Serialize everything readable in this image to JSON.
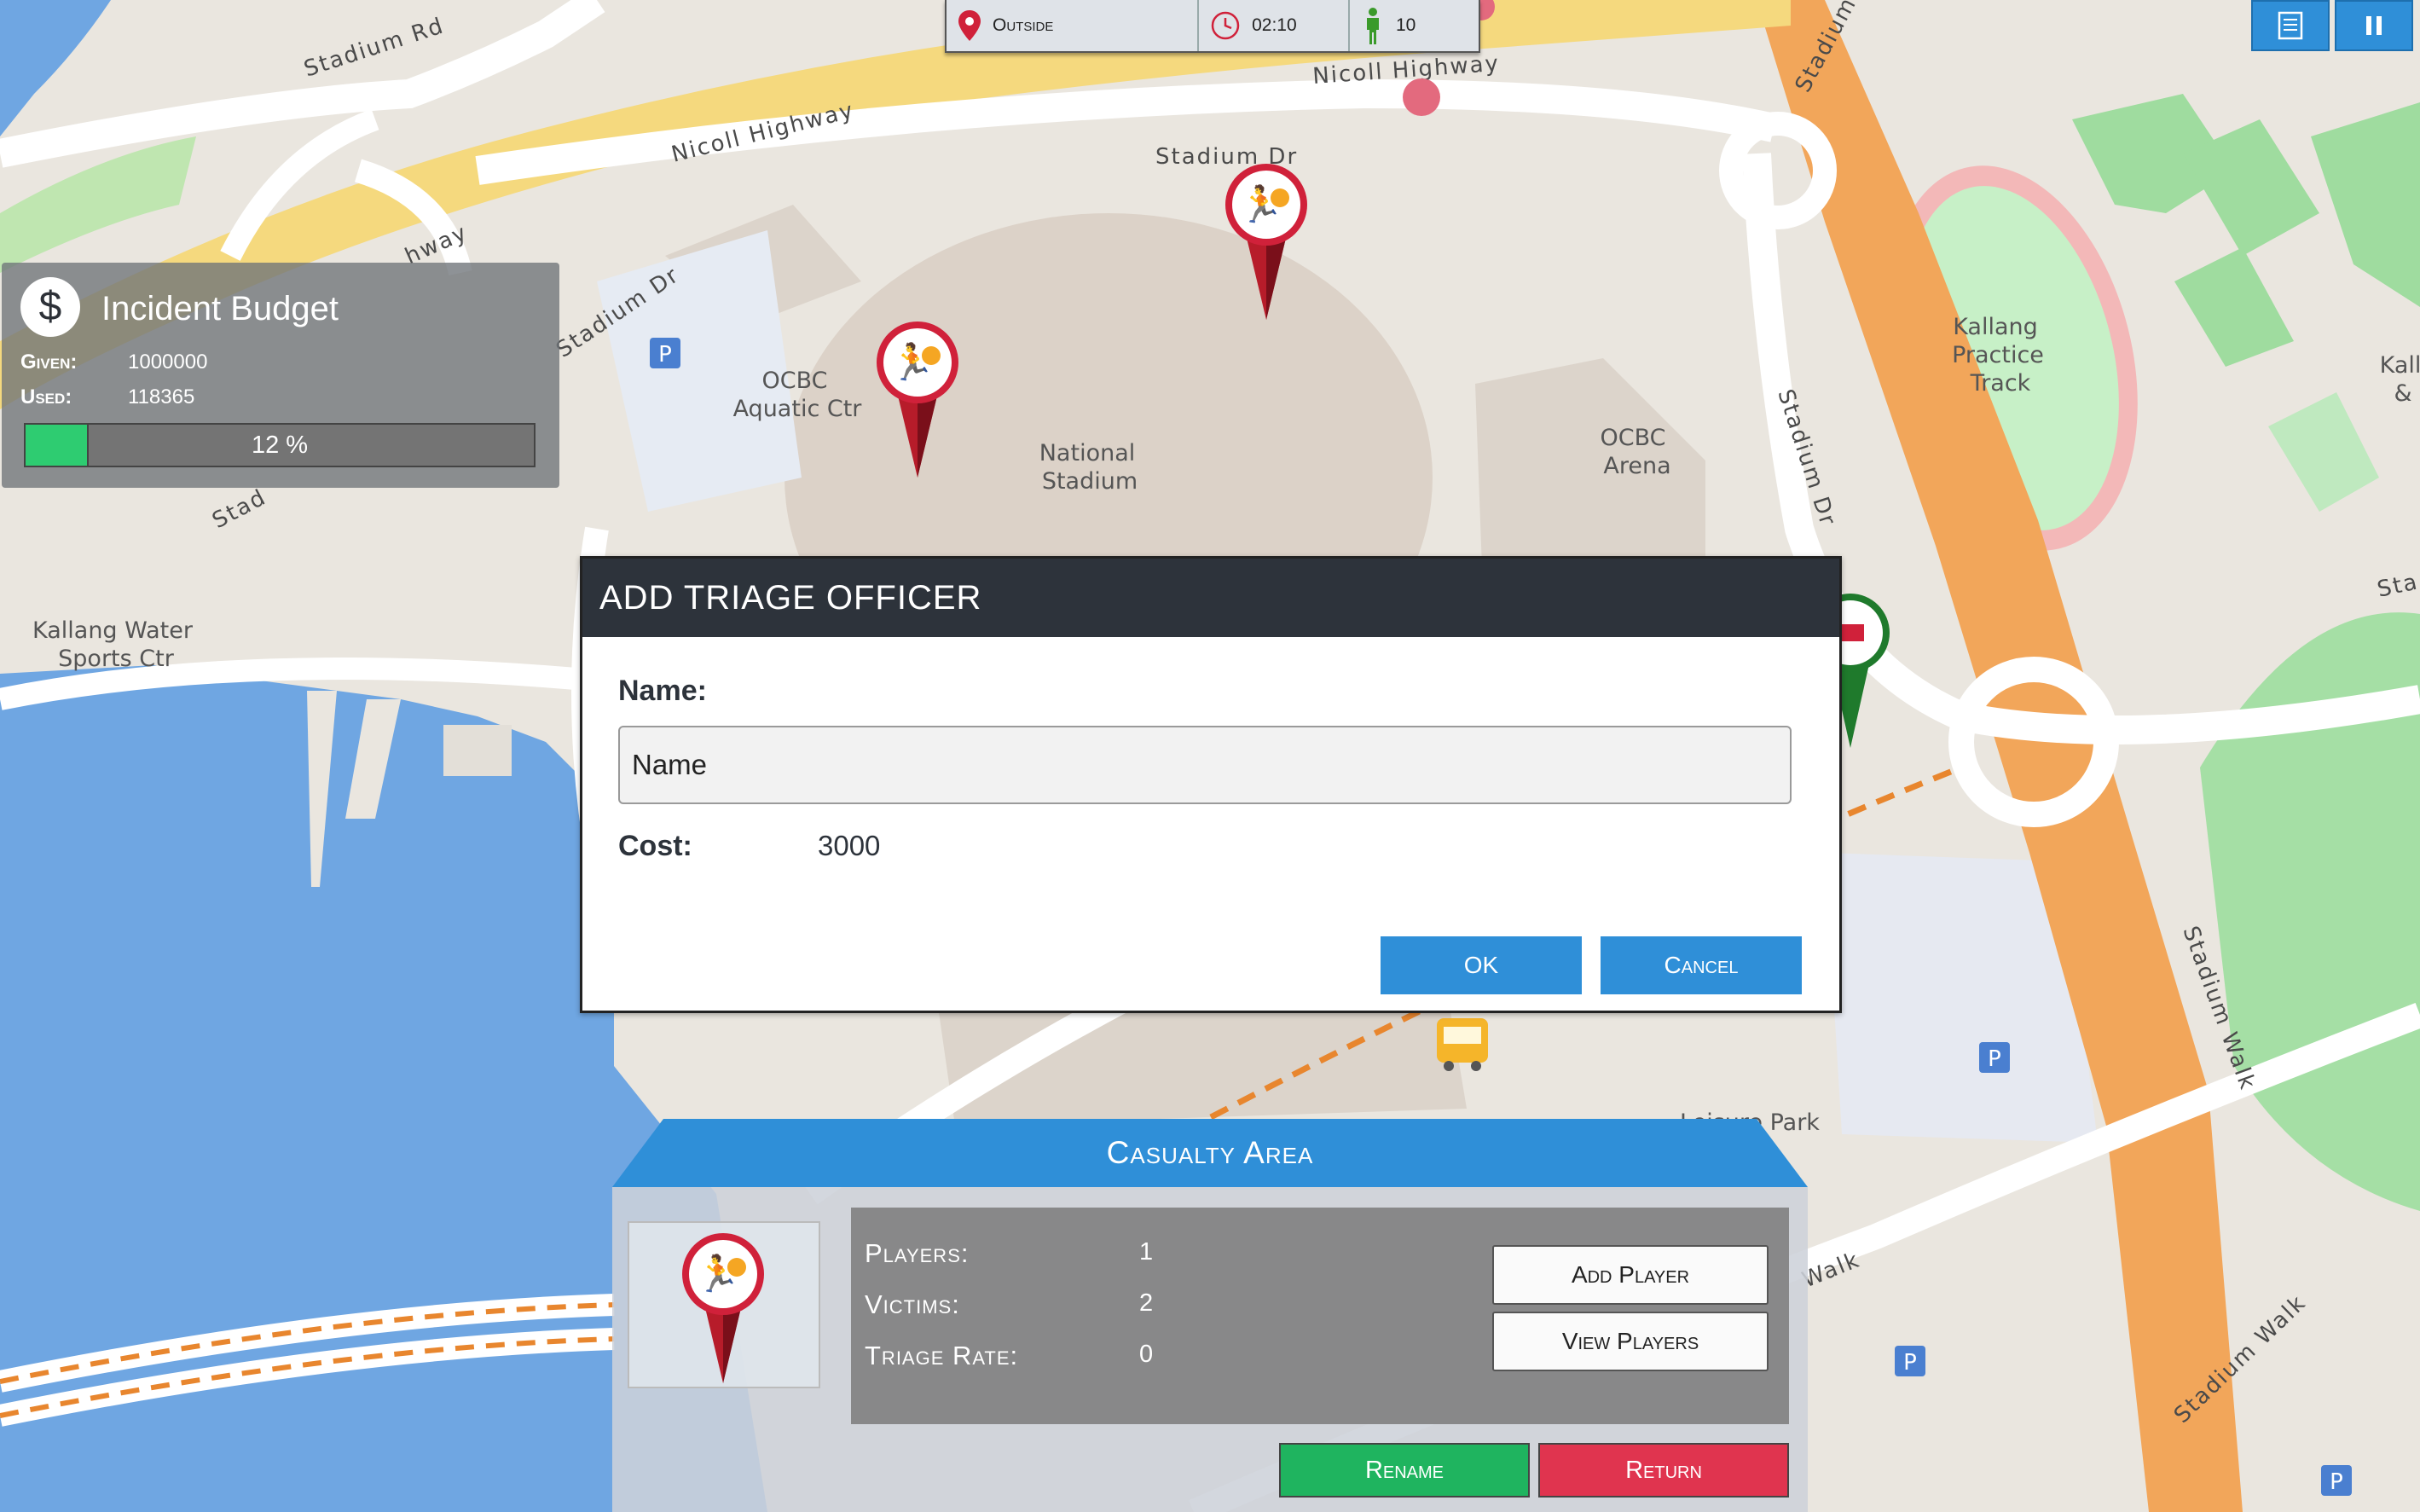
{
  "map": {
    "labels": {
      "stadium_rd": "Stadium Rd",
      "nicoll_highway_1": "Nicoll Highway",
      "nicoll_highway_2": "Nicoll Highway",
      "highway_partial": "hway",
      "stadium_dr_top": "Stadium Dr",
      "stadium_dr_left": "Stadium Dr",
      "stadium_dr_right": "Stadium Dr",
      "stadium_top_right": "Stadium",
      "stad_left": "Stad",
      "stad_right": "Sta",
      "ocbc_aquatic_1": "OCBC",
      "ocbc_aquatic_2": "Aquatic Ctr",
      "national_1": "National",
      "national_2": "Stadium",
      "ocbc_arena_1": "OCBC",
      "ocbc_arena_2": "Arena",
      "kallang_track_1": "Kallang",
      "kallang_track_2": "Practice",
      "kallang_track_3": "Track",
      "kallang_water_1": "Kallang Water",
      "kallang_water_2": "Sports Ctr",
      "leisure_park": "Leisure Park",
      "stadium_walk_1": "Stadium Walk",
      "stadium_walk_2": "Stadium Walk",
      "walk": "Walk",
      "kall_edge_1": "Kall",
      "kall_edge_2": "&"
    }
  },
  "status_bar": {
    "location": "Outside",
    "time": "02:10",
    "players": "10"
  },
  "budget": {
    "title": "Incident Budget",
    "given_label": "Given:",
    "given_value": "1000000",
    "used_label": "Used:",
    "used_value": "118365",
    "progress_text": "12 %",
    "progress_fraction": 0.12
  },
  "dialog": {
    "title": "ADD TRIAGE OFFICER",
    "name_label": "Name:",
    "name_value": "Name",
    "cost_label": "Cost:",
    "cost_value": "3000",
    "ok_label": "OK",
    "cancel_label": "Cancel"
  },
  "casualty_area": {
    "title": "Casualty Area",
    "players_label": "Players:",
    "players_value": "1",
    "victims_label": "Victims:",
    "victims_value": "2",
    "triage_rate_label": "Triage Rate:",
    "triage_rate_value": "0",
    "add_player_label": "Add Player",
    "view_players_label": "View Players",
    "rename_label": "Rename",
    "return_label": "Return"
  },
  "colors": {
    "accent_blue": "#2f8fd8",
    "header_dark": "#2d333b",
    "green": "#1fb45f",
    "red": "#e0344f",
    "progress_green": "#2ecc71"
  },
  "icons": [
    "map-pin-icon",
    "clock-icon",
    "person-icon",
    "document-icon",
    "pause-icon",
    "dollar-icon",
    "incident-marker-icon",
    "ambulance-marker-icon",
    "bus-icon",
    "parking-icon"
  ]
}
